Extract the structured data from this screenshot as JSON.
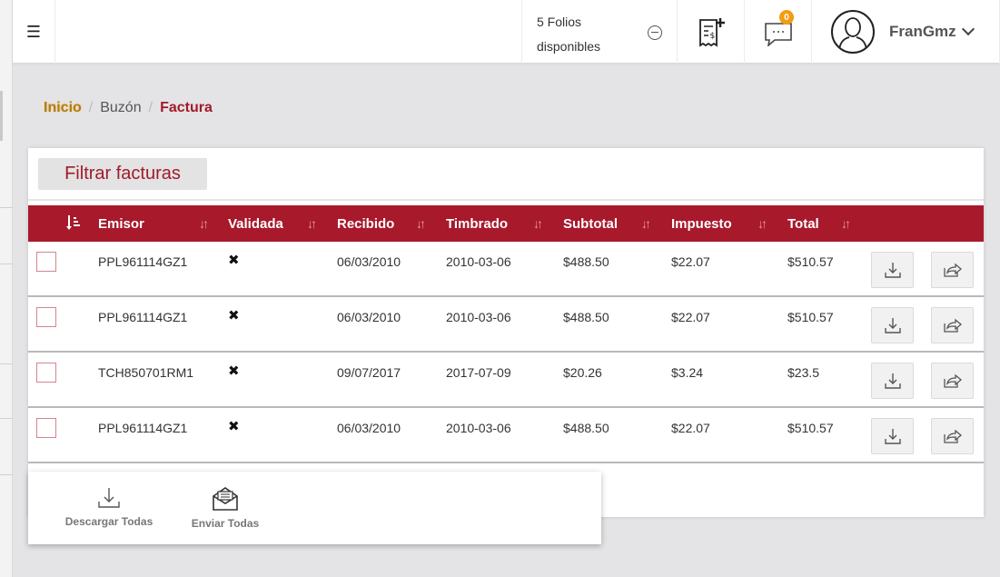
{
  "header": {
    "folios_text": "5 Folios disponibles",
    "notification_count": "0",
    "username": "FranGmz"
  },
  "breadcrumb": {
    "home": "Inicio",
    "middle": "Buzón",
    "current": "Factura"
  },
  "filter_button": "Filtrar facturas",
  "table": {
    "headers": [
      "Emisor",
      "Validada",
      "Recibido",
      "Timbrado",
      "Subtotal",
      "Impuesto",
      "Total"
    ],
    "rows": [
      {
        "emisor": "PPL961114GZ1",
        "recibido": "06/03/2010",
        "timbrado": "2010-03-06",
        "subtotal": "$488.50",
        "impuesto": "$22.07",
        "total": "$510.57"
      },
      {
        "emisor": "PPL961114GZ1",
        "recibido": "06/03/2010",
        "timbrado": "2010-03-06",
        "subtotal": "$488.50",
        "impuesto": "$22.07",
        "total": "$510.57"
      },
      {
        "emisor": "TCH850701RM1",
        "recibido": "09/07/2017",
        "timbrado": "2017-07-09",
        "subtotal": "$20.26",
        "impuesto": "$3.24",
        "total": "$23.5"
      },
      {
        "emisor": "PPL961114GZ1",
        "recibido": "06/03/2010",
        "timbrado": "2010-03-06",
        "subtotal": "$488.50",
        "impuesto": "$22.07",
        "total": "$510.57"
      }
    ]
  },
  "bulk_actions": {
    "download_all": "Descargar Todas",
    "send_all": "Enviar Todas"
  },
  "colors": {
    "primary": "#a8192b",
    "accent": "#b07c14",
    "badge": "#f39c12"
  },
  "icons": [
    "menu-icon",
    "minus-circle-icon",
    "invoice-add-icon",
    "chat-icon",
    "user-avatar-icon",
    "chevron-down-icon",
    "sort-icon",
    "x-mark-icon",
    "download-icon",
    "share-icon",
    "envelope-icon"
  ]
}
